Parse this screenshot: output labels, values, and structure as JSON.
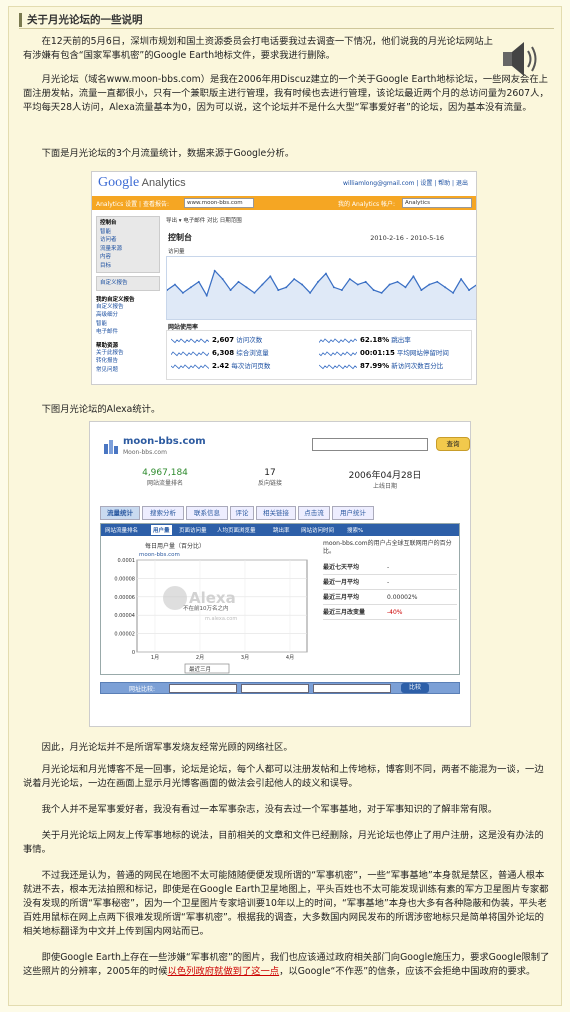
{
  "article": {
    "heading": "关于月光论坛的一些说明",
    "p1": "　　在12天前的5月6日，深圳市规划和国土资源委员会打电话要我过去调查一下情况，他们说我的月光论坛网站上有涉嫌有包含“国家军事机密”的Google Earth地标文件，要求我进行删除。",
    "p2": "　　月光论坛（域名www.moon-bbs.com）是我在2006年用Discuz建立的一个关于Google Earth地标论坛，一些网友会在上面注册发帖，流量一直都很小，只有一个兼职版主进行管理，我有时候也去进行管理，该论坛最近两个月的总访问量为2607人，平均每天28人访问，Alexa流量基本为0，因为可以说，这个论坛并不是什么大型“军事爱好者”的论坛，因为基本没有流量。",
    "p3": "　　下面是月光论坛的3个月流量统计，数据来源于Google分析。",
    "p4": "　　下图月光论坛的Alexa统计。",
    "p5": "　　因此，月光论坛并不是所谓军事发烧友经常光顾的网络社区。",
    "p6": "　　月光论坛和月光博客不是一回事，论坛是论坛，每个人都可以注册发帖和上传地标，博客则不同，两者不能混为一谈，一边说着月光论坛，一边在画面上显示月光博客画面的做法会引起他人的歧义和误导。",
    "p7": "　　我个人并不是军事爱好者，我没有看过一本军事杂志，没有去过一个军事基地，对于军事知识的了解非常有限。",
    "p8": "　　关于月光论坛上网友上传军事地标的说法，目前相关的文章和文件已经删除，月光论坛也停止了用户注册，这是没有办法的事情。",
    "p9": "　　不过我还是认为，普通的网民在地图不太可能随随便便发现所谓的“军事机密”，一些“军事基地”本身就是禁区，普通人根本就进不去，根本无法拍照和标记，即使是在Google Earth卫星地图上，平头百姓也不太可能发现训练有素的军方卫星图片专家都没有发现的所谓“军事秘密”，因为一个卫星图片专家培训要10年以上的时间，“军事基地”本身也大多有各种隐蔽和伪装，平头老百姓用鼠标在网上点两下很难发现所谓“军事机密”。根据我的调查，大多数国内网民发布的所谓涉密地标只是简单将国外论坛的相关地标翻译为中文并上传到国内网站而已。",
    "p10a": "　　即使Google Earth上存在一些涉嫌“军事机密”的图片，我们也应该通过政府相关部门向Google施压力，要求Google限制了这些照片的分辨率，2005年的时候",
    "p10link": "以色列政府就做到了这一点",
    "p10b": "，以Google“不作恶”的信条，应该不会拒绝中国政府的要求。"
  },
  "ga": {
    "logo_main": "Google",
    "logo_sub": " Analytics",
    "email": "williamlong@gmail.com | 设置 | 帮助 | 退出",
    "bar_label": "Analytics 设置  |  查看报告:",
    "site_select": "www.moon-bbs.com",
    "account_label": "我的 Analytics 帐户:",
    "account_select": "Analytics",
    "tabs": "导出 ▾   电子邮件          对比          日期范围",
    "title": "控制台",
    "date_range": "2010-2-16 - 2010-5-16",
    "graph_by": "访问量",
    "site_usage": "网站使用率",
    "side_items": [
      "控制台",
      "智能",
      "访问者",
      "流量来源",
      "内容",
      "目标"
    ],
    "side_custom": "自定义报告",
    "side_custom_h": "我的自定义报告",
    "side_custom_items": [
      "自定义报告",
      "高级细分",
      "智能",
      "电子邮件"
    ],
    "side_help_h": "帮助资源",
    "side_help_items": [
      "关于此报告",
      "转化报告",
      "常见问题"
    ],
    "stats": [
      {
        "value": "2,607",
        "label": "访问次数"
      },
      {
        "value": "6,308",
        "label": "综合浏览量"
      },
      {
        "value": "2.42",
        "label": "每次访问页数"
      },
      {
        "value": "62.18%",
        "label": "跳出率"
      },
      {
        "value": "00:01:15",
        "label": "平均网站停留时间"
      },
      {
        "value": "87.99%",
        "label": "新访问次数百分比"
      }
    ],
    "overview_series": [
      9,
      11,
      8,
      10,
      12,
      7,
      16,
      13,
      9,
      12,
      10,
      8,
      11,
      14,
      9,
      10,
      13,
      11,
      8,
      12,
      15,
      10,
      9,
      13,
      11,
      12,
      9,
      8,
      11,
      12,
      10,
      14,
      9,
      11,
      12,
      10,
      8,
      13,
      9,
      11
    ]
  },
  "alexa": {
    "site": "moon-bbs.com",
    "site_sub": "Moon-bbs.com",
    "search_btn": "查询",
    "rank_value": "4,967,184",
    "rank_label": "网站流量排名",
    "links_value": "17",
    "links_label": "反向链接",
    "date_value": "2006年04月28日",
    "date_label": "上线日期",
    "tabs": [
      "流量统计",
      "搜索分析",
      "联系信息",
      "评论",
      "相关链接",
      "点击流",
      "用户统计"
    ],
    "subtabs": [
      "网站流量排名",
      "用户量",
      "页面访问量",
      "人均页面浏览量",
      "跳出率",
      "网站访问时间",
      "搜索%"
    ],
    "chart_title": "每日用户量（百分比）",
    "chart_site": "moon-bbs.com",
    "chart_note": "不在前10万名之内",
    "y_ticks": [
      "0.0001",
      "0.00008",
      "0.00006",
      "0.00004",
      "0.00002",
      "0"
    ],
    "x_ticks": [
      "1月",
      "2月",
      "3月",
      "4月"
    ],
    "range_select": "最近三月",
    "watermark": "Alexa",
    "watermark_sub": "m.alexa.com",
    "side_desc": "moon-bbs.com的用户占全球互联网用户的百分比。",
    "rows": [
      {
        "label": "最近七天平均",
        "value": "-"
      },
      {
        "label": "最近一月平均",
        "value": "-"
      },
      {
        "label": "最近三月平均",
        "value": "0.00002%"
      },
      {
        "label": "最近三月改变量",
        "value": "-40%"
      }
    ],
    "compare_label": "网址比较:",
    "compare_btn": "比较"
  }
}
